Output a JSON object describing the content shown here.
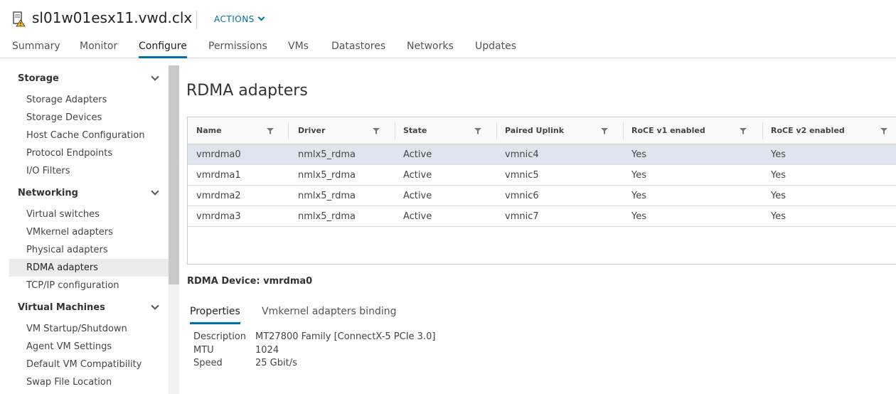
{
  "header": {
    "host_name": "sl01w01esx11.vwd.clx",
    "actions_label": "ACTIONS",
    "tabs": [
      {
        "label": "Summary"
      },
      {
        "label": "Monitor"
      },
      {
        "label": "Configure"
      },
      {
        "label": "Permissions"
      },
      {
        "label": "VMs"
      },
      {
        "label": "Datastores"
      },
      {
        "label": "Networks"
      },
      {
        "label": "Updates"
      }
    ],
    "active_tab": "Configure"
  },
  "sidebar": {
    "groups": [
      {
        "label": "Storage",
        "items": [
          "Storage Adapters",
          "Storage Devices",
          "Host Cache Configuration",
          "Protocol Endpoints",
          "I/O Filters"
        ]
      },
      {
        "label": "Networking",
        "items": [
          "Virtual switches",
          "VMkernel adapters",
          "Physical adapters",
          "RDMA adapters",
          "TCP/IP configuration"
        ]
      },
      {
        "label": "Virtual Machines",
        "items": [
          "VM Startup/Shutdown",
          "Agent VM Settings",
          "Default VM Compatibility",
          "Swap File Location"
        ]
      }
    ],
    "selected_item": "RDMA adapters"
  },
  "main": {
    "title": "RDMA adapters",
    "columns": [
      "Name",
      "Driver",
      "State",
      "Paired Uplink",
      "RoCE v1 enabled",
      "RoCE v2 enabled"
    ],
    "rows": [
      [
        "vmrdma0",
        "nmlx5_rdma",
        "Active",
        "vmnic4",
        "Yes",
        "Yes"
      ],
      [
        "vmrdma1",
        "nmlx5_rdma",
        "Active",
        "vmnic5",
        "Yes",
        "Yes"
      ],
      [
        "vmrdma2",
        "nmlx5_rdma",
        "Active",
        "vmnic6",
        "Yes",
        "Yes"
      ],
      [
        "vmrdma3",
        "nmlx5_rdma",
        "Active",
        "vmnic7",
        "Yes",
        "Yes"
      ]
    ],
    "selected_row": 0,
    "device_label": "RDMA Device: vmrdma0",
    "subtabs": [
      {
        "label": "Properties"
      },
      {
        "label": "Vmkernel adapters binding"
      }
    ],
    "active_subtab": "Properties",
    "properties": [
      {
        "key": "Description",
        "value": "MT27800 Family  [ConnectX-5 PCIe 3.0]"
      },
      {
        "key": "MTU",
        "value": "1024"
      },
      {
        "key": "Speed",
        "value": "25 Gbit/s"
      }
    ]
  },
  "colors": {
    "accent": "#0072a3",
    "selected_row": "#dde5ee",
    "selected_nav": "#ececec",
    "warning": "#f5c518"
  },
  "icons": {
    "host": "host-warning-icon",
    "filter": "filter-icon",
    "chevron": "chevron-down-icon"
  }
}
